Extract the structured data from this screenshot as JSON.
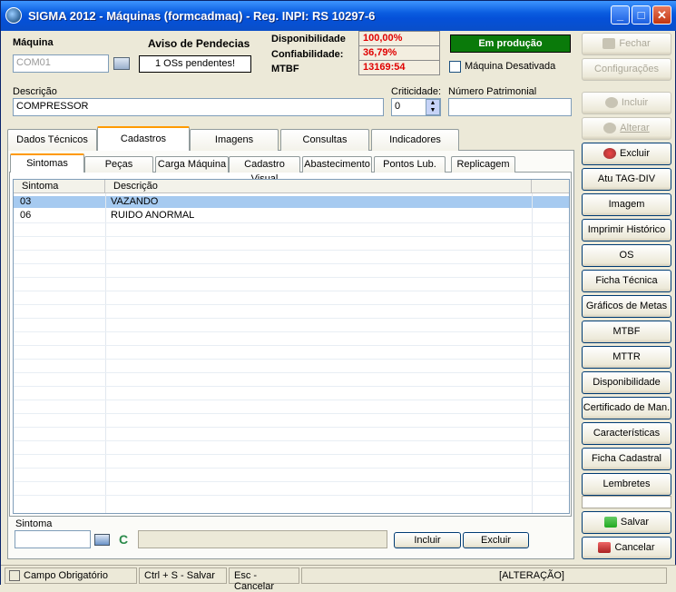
{
  "window": {
    "title": "SIGMA 2012 - Máquinas  (formcadmaq)  - Reg. INPI: RS 10297-6",
    "minimize": "_",
    "maximize": "□",
    "close": "✕"
  },
  "header": {
    "maquina_label": "Máquina",
    "maquina_value": "COM01",
    "aviso_label": "Aviso de Pendecias",
    "aviso_value": "1  OSs pendentes!",
    "disponibilidade_label": "Disponibilidade",
    "disponibilidade_value": "100,00%",
    "confiabilidade_label": "Confiabilidade:",
    "confiabilidade_value": "36,79%",
    "mtbf_label": "MTBF",
    "mtbf_value": "13169:54",
    "status_value": "Em produção",
    "status_color": "#0a7a0a",
    "desativada_label": "Máquina Desativada"
  },
  "fields": {
    "descricao_label": "Descrição",
    "descricao_value": "COMPRESSOR",
    "criticidade_label": "Criticidade:",
    "criticidade_value": "0",
    "patrimonial_label": "Número Patrimonial",
    "patrimonial_value": ""
  },
  "tabs": [
    "Dados Técnicos",
    "Cadastros",
    "Imagens",
    "Consultas",
    "Indicadores"
  ],
  "subtabs": [
    "Sintomas",
    "Peças",
    "Carga Máquina",
    "Cadastro Visual",
    "Abastecimento",
    "Pontos Lub.",
    "Replicagem"
  ],
  "grid": {
    "columns": [
      "Sintoma",
      "Descrição"
    ],
    "rows": [
      {
        "sintoma": "03",
        "descricao": "VAZANDO"
      },
      {
        "sintoma": "06",
        "descricao": "RUIDO ANORMAL"
      }
    ]
  },
  "bottom": {
    "sintoma_label": "Sintoma",
    "sintoma_value": "",
    "c_label": "C",
    "incluir": "Incluir",
    "excluir": "Excluir"
  },
  "right_buttons": {
    "fechar": "Fechar",
    "configuracoes": "Configurações",
    "incluir": "Incluir",
    "alterar": "Alterar",
    "excluir": "Excluir",
    "atu_tag": "Atu TAG-DIV",
    "imagem": "Imagem",
    "imprimir_historico": "Imprimir Histórico",
    "os": "OS",
    "ficha_tecnica": "Ficha Técnica",
    "graficos_metas": "Gráficos de Metas",
    "mtbf": "MTBF",
    "mttr": "MTTR",
    "disponibilidade": "Disponibilidade",
    "certificado": "Certificado de Man.",
    "caracteristicas": "Características",
    "ficha_cadastral": "Ficha Cadastral",
    "lembretes": "Lembretes",
    "salvar": "Salvar",
    "cancelar": "Cancelar"
  },
  "statusbar": {
    "campo": "Campo Obrigatório",
    "salvar": "Ctrl + S - Salvar",
    "cancelar": "Esc - Cancelar",
    "modo": "[ALTERAÇÃO]"
  }
}
